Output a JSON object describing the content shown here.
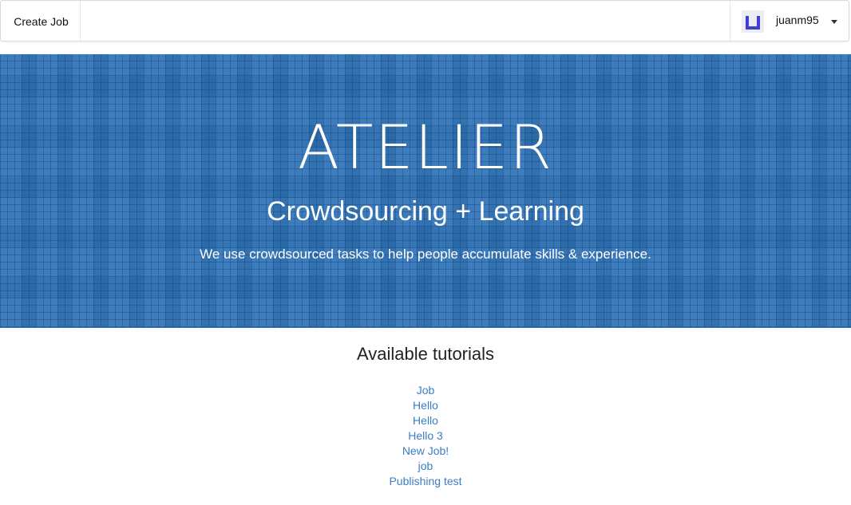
{
  "navbar": {
    "create_job_label": "Create Job",
    "username": "juanm95",
    "avatar_icon": "identicon-avatar",
    "caret_icon": "caret-down-icon"
  },
  "hero": {
    "title": "ATELIER",
    "subtitle": "Crowdsourcing + Learning",
    "tagline": "We use crowdsourced tasks to help people accumulate skills & experience.",
    "background_color": "#2f74b8"
  },
  "tutorials": {
    "heading": "Available tutorials",
    "items": [
      "Job",
      "Hello",
      "Hello",
      "Hello 3",
      "New Job!",
      "job",
      "Publishing test"
    ],
    "link_color": "#3b7dc4"
  }
}
